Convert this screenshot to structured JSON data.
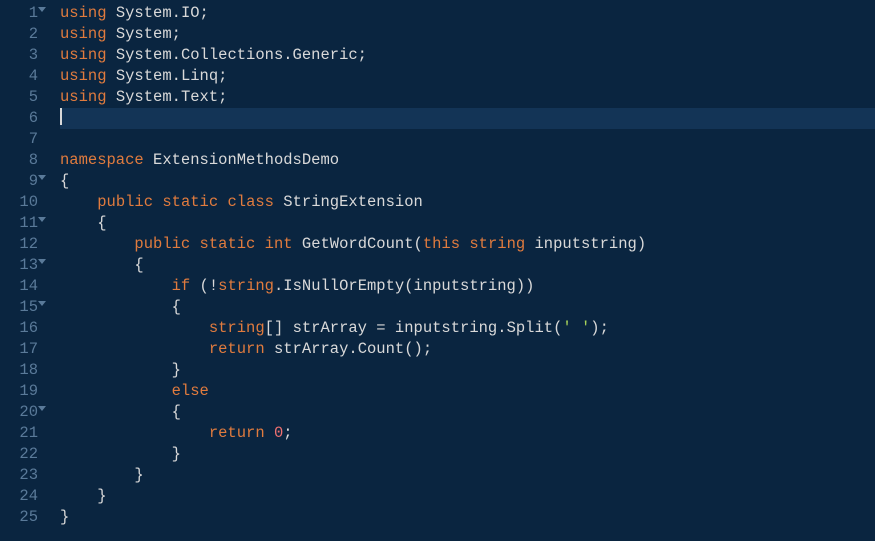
{
  "gutter": {
    "lines": [
      {
        "num": "1",
        "fold": true
      },
      {
        "num": "2",
        "fold": false
      },
      {
        "num": "3",
        "fold": false
      },
      {
        "num": "4",
        "fold": false
      },
      {
        "num": "5",
        "fold": false
      },
      {
        "num": "6",
        "fold": false
      },
      {
        "num": "7",
        "fold": false
      },
      {
        "num": "8",
        "fold": false
      },
      {
        "num": "9",
        "fold": true
      },
      {
        "num": "10",
        "fold": false
      },
      {
        "num": "11",
        "fold": true
      },
      {
        "num": "12",
        "fold": false
      },
      {
        "num": "13",
        "fold": true
      },
      {
        "num": "14",
        "fold": false
      },
      {
        "num": "15",
        "fold": true
      },
      {
        "num": "16",
        "fold": false
      },
      {
        "num": "17",
        "fold": false
      },
      {
        "num": "18",
        "fold": false
      },
      {
        "num": "19",
        "fold": false
      },
      {
        "num": "20",
        "fold": true
      },
      {
        "num": "21",
        "fold": false
      },
      {
        "num": "22",
        "fold": false
      },
      {
        "num": "23",
        "fold": false
      },
      {
        "num": "24",
        "fold": false
      },
      {
        "num": "25",
        "fold": false
      }
    ]
  },
  "code": {
    "l1": {
      "using": "using",
      "ns": "System.IO",
      "semi": ";"
    },
    "l2": {
      "using": "using",
      "ns": "System",
      "semi": ";"
    },
    "l3": {
      "using": "using",
      "ns": "System.Collections.Generic",
      "semi": ";"
    },
    "l4": {
      "using": "using",
      "ns": "System.Linq",
      "semi": ";"
    },
    "l5": {
      "using": "using",
      "ns": "System.Text",
      "semi": ";"
    },
    "l8": {
      "namespace": "namespace",
      "name": "ExtensionMethodsDemo"
    },
    "l9": {
      "brace": "{"
    },
    "l10": {
      "public": "public",
      "static": "static",
      "class": "class",
      "name": "StringExtension"
    },
    "l11": {
      "brace": "{"
    },
    "l12": {
      "public": "public",
      "static": "static",
      "rettype": "int",
      "method": "GetWordCount",
      "lparen": "(",
      "this": "this",
      "paramtype": "string",
      "paramname": "inputstring",
      "rparen": ")"
    },
    "l13": {
      "brace": "{"
    },
    "l14": {
      "if": "if",
      "lparen": "(",
      "neg": "!",
      "strtype": "string",
      "dot": ".",
      "method": "IsNullOrEmpty",
      "lparen2": "(",
      "arg": "inputstring",
      "rparen2": ")",
      "rparen": ")"
    },
    "l15": {
      "brace": "{"
    },
    "l16": {
      "type": "string",
      "brackets": "[]",
      "var": "strArray",
      "eq": "=",
      "obj": "inputstring",
      "dot": ".",
      "method": "Split",
      "lparen": "(",
      "str": "' '",
      "rparen": ")",
      "semi": ";"
    },
    "l17": {
      "return": "return",
      "obj": "strArray",
      "dot": ".",
      "method": "Count",
      "lparen": "(",
      "rparen": ")",
      "semi": ";"
    },
    "l18": {
      "brace": "}"
    },
    "l19": {
      "else": "else"
    },
    "l20": {
      "brace": "{"
    },
    "l21": {
      "return": "return",
      "num": "0",
      "semi": ";"
    },
    "l22": {
      "brace": "}"
    },
    "l23": {
      "brace": "}"
    },
    "l24": {
      "brace": "}"
    },
    "l25": {
      "brace": "}"
    }
  }
}
